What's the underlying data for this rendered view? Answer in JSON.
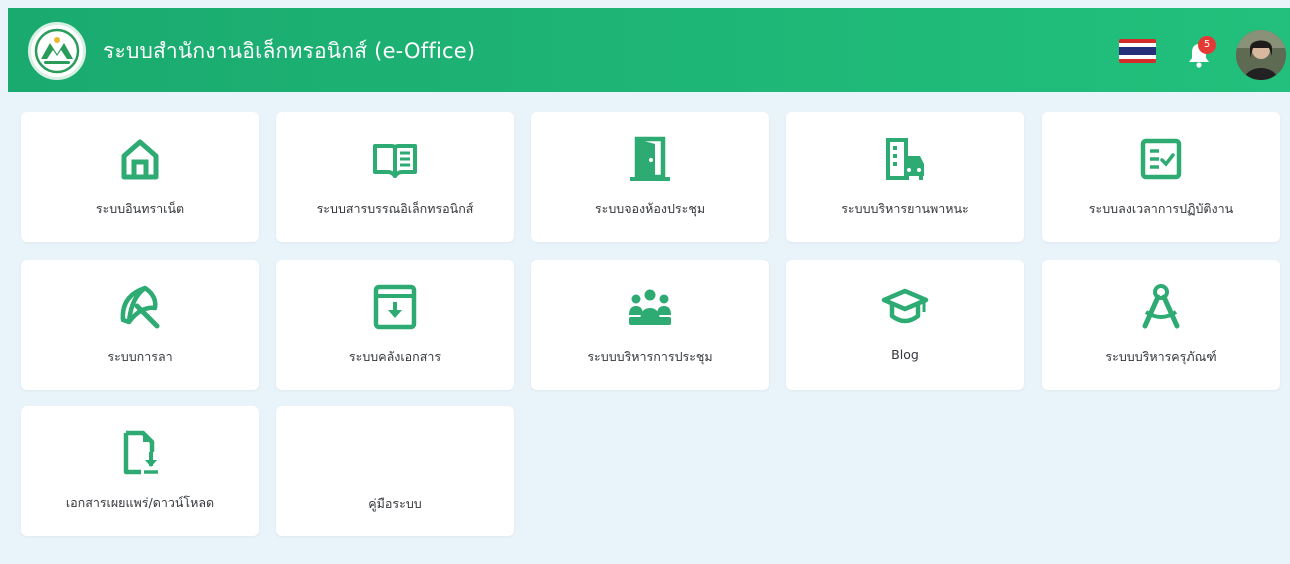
{
  "header": {
    "title": "ระบบสำนักงานอิเล็กทรอนิกส์ (e-Office)",
    "notification_count": "5",
    "accent_color": "#1eb273"
  },
  "menu": {
    "items": [
      {
        "label": "ระบบอินทราเน็ต",
        "icon": "home-icon"
      },
      {
        "label": "ระบบสารบรรณอิเล็กทรอนิกส์",
        "icon": "book-open-icon"
      },
      {
        "label": "ระบบจองห้องประชุม",
        "icon": "door-icon"
      },
      {
        "label": "ระบบบริหารยานพาหนะ",
        "icon": "building-car-icon"
      },
      {
        "label": "ระบบลงเวลาการปฏิบัติงาน",
        "icon": "checklist-icon"
      },
      {
        "label": "ระบบการลา",
        "icon": "umbrella-beach-icon"
      },
      {
        "label": "ระบบคลังเอกสาร",
        "icon": "archive-download-icon"
      },
      {
        "label": "ระบบบริหารการประชุม",
        "icon": "people-group-icon"
      },
      {
        "label": "Blog",
        "icon": "graduation-cap-icon"
      },
      {
        "label": "ระบบบริหารครุภัณฑ์",
        "icon": "compass-drafting-icon"
      },
      {
        "label": "เอกสารเผยแพร่/ดาวน์โหลด",
        "icon": "file-download-icon"
      },
      {
        "label": "คู่มือระบบ",
        "icon": ""
      }
    ]
  }
}
